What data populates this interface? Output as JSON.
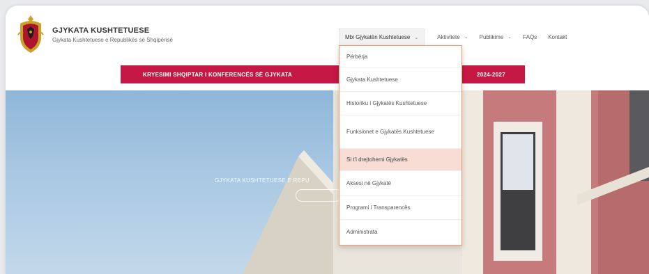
{
  "header": {
    "title": "GJYKATA KUSHTETUESE",
    "subtitle": "Gjykata Kushtetuese e Republikës së Shqipërisë"
  },
  "nav": {
    "items": [
      {
        "label": "Mbi Gjykatën Kushtetuese",
        "has_chevron": true
      },
      {
        "label": "Aktivitete",
        "has_chevron": true
      },
      {
        "label": "Publikime",
        "has_chevron": true
      },
      {
        "label": "FAQs",
        "has_chevron": false
      },
      {
        "label": "Kontakt",
        "has_chevron": false
      }
    ],
    "chevron": "⌄"
  },
  "dropdown": {
    "items": [
      "Përbërja",
      "Gjykata Kushtetuese",
      "Historiku i Gjykatës Kushtetuese",
      "Funksionet e Gjykatës Kushtetuese",
      "Si t'i drejtohemi Gjykatës",
      "Aksesi në Gjykatë",
      "Programi i Transparencës",
      "Administrata"
    ],
    "highlighted_index": 4
  },
  "banner": {
    "left": "KRYESIMI SHQIPTAR I KONFERENCËS SË GJYKATA",
    "right": "2024-2027"
  },
  "hero": {
    "title": "GJYKATA KUSHTETUESE E REPU"
  },
  "colors": {
    "banner": "#c51845",
    "dropdown_border": "#ef9a6b",
    "dropdown_highlight": "#f7ddd3"
  }
}
